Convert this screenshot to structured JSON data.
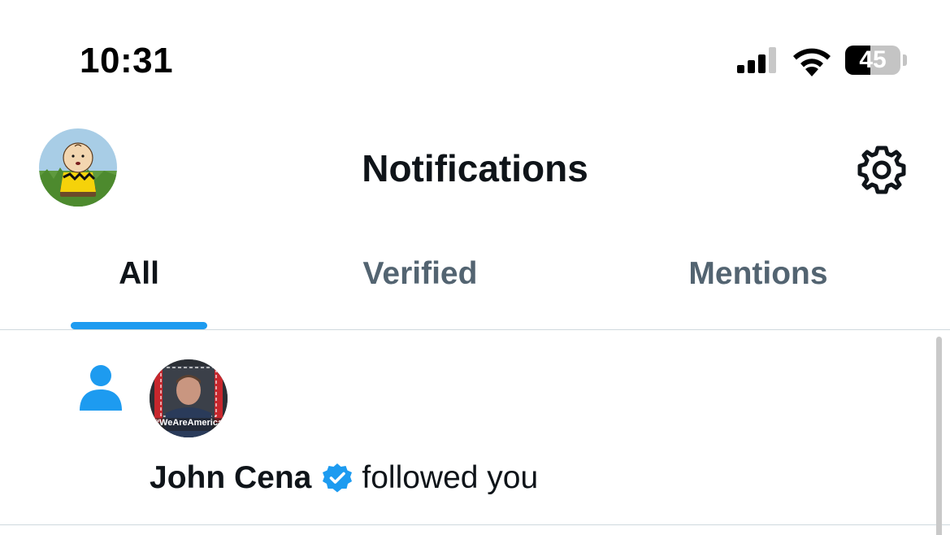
{
  "status_bar": {
    "time": "10:31",
    "battery": "45",
    "battery_level": 0.45,
    "icons": [
      "cellular-signal-icon",
      "wifi-icon",
      "battery-icon"
    ]
  },
  "header": {
    "title": "Notifications",
    "avatar_icon": "profile-avatar",
    "settings_icon": "gear-icon"
  },
  "tabs": [
    {
      "label": "All",
      "active": true
    },
    {
      "label": "Verified",
      "active": false
    },
    {
      "label": "Mentions",
      "active": false
    }
  ],
  "notifications": [
    {
      "type_icon": "person-icon",
      "name": "John Cena",
      "verified": true,
      "action": "followed you",
      "avatar_caption": "#WeAreAmerica"
    }
  ],
  "colors": {
    "accent": "#1d9bf0",
    "text_primary": "#0f1419",
    "text_secondary": "#536471",
    "divider": "#cfd9de"
  }
}
